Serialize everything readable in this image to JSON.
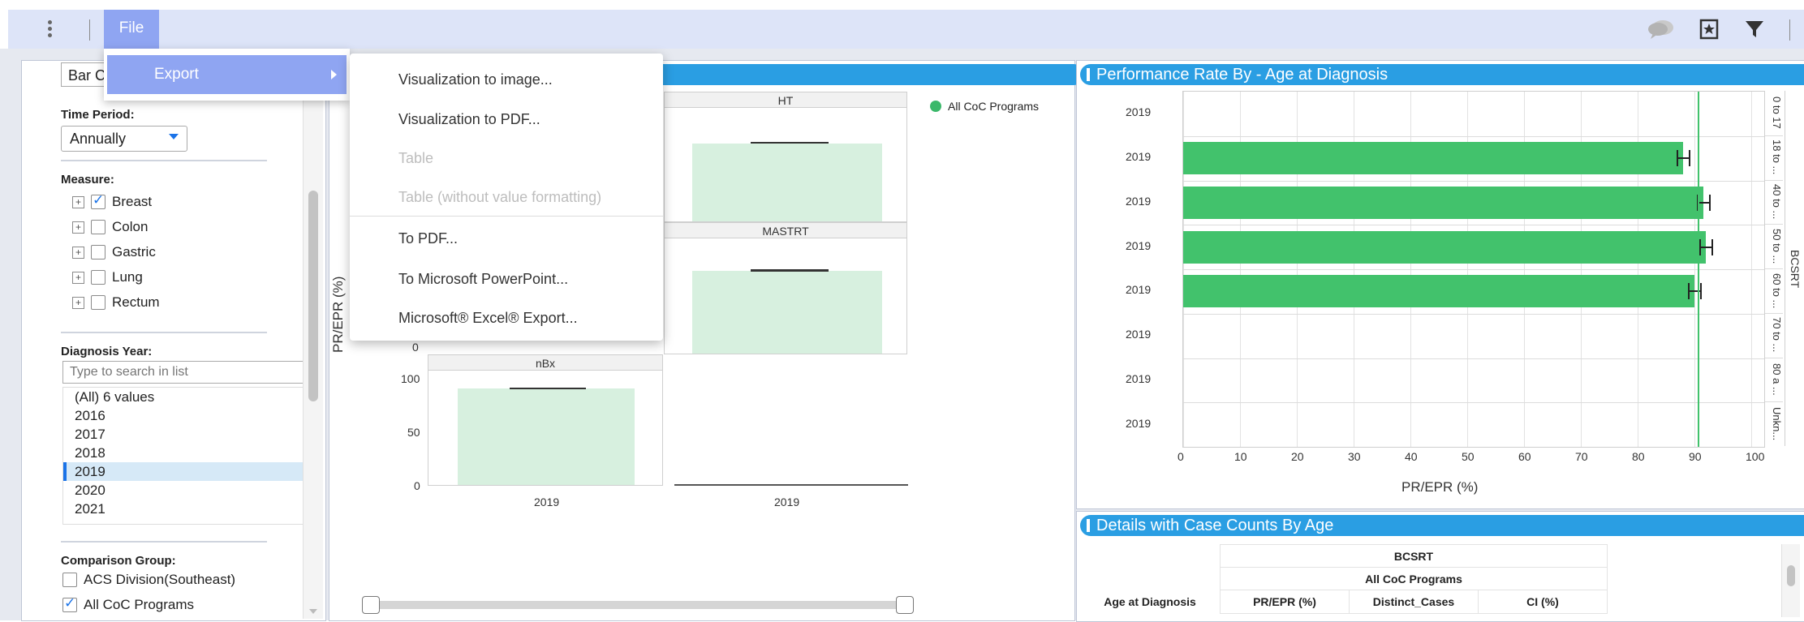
{
  "toolbar": {
    "file_label": "File",
    "icons": [
      "more-vert-icon",
      "comments-icon",
      "bookmark-star-icon",
      "filter-icon"
    ]
  },
  "file_menu": {
    "export_label": "Export"
  },
  "export_submenu": {
    "items": [
      {
        "label": "Visualization to image...",
        "enabled": true
      },
      {
        "label": "Visualization to PDF...",
        "enabled": true
      },
      {
        "label": "Table",
        "enabled": false
      },
      {
        "label": "Table (without value formatting)",
        "enabled": false
      },
      {
        "label": "To PDF...",
        "enabled": true
      },
      {
        "label": "To Microsoft PowerPoint...",
        "enabled": true
      },
      {
        "label": "Microsoft® Excel® Export...",
        "enabled": true
      }
    ]
  },
  "filters": {
    "chart_type_value": "Bar C",
    "time_period_label": "Time Period:",
    "time_period_value": "Annually",
    "measure_label": "Measure:",
    "measures": [
      {
        "label": "Breast",
        "checked": true
      },
      {
        "label": "Colon",
        "checked": false
      },
      {
        "label": "Gastric",
        "checked": false
      },
      {
        "label": "Lung",
        "checked": false
      },
      {
        "label": "Rectum",
        "checked": false
      }
    ],
    "diagnosis_year_label": "Diagnosis Year:",
    "search_placeholder": "Type to search in list",
    "years": [
      "(All) 6 values",
      "2016",
      "2017",
      "2018",
      "2019",
      "2020",
      "2021"
    ],
    "selected_year": "2019",
    "comparison_group_label": "Comparison Group:",
    "comparison_groups": [
      {
        "label": "ACS Division(Southeast)",
        "checked": false
      },
      {
        "label": "All CoC Programs",
        "checked": true
      }
    ]
  },
  "viz_panel": {
    "ylabel": "PR/EPR (%)",
    "legend": "All CoC Programs",
    "legend_color": "#3bb86a",
    "facets": [
      {
        "label": "HT",
        "value": 90
      },
      {
        "label": "MASTRT",
        "value": 93
      },
      {
        "label": "nBx",
        "value": 92
      }
    ],
    "yticks": [
      "100",
      "50",
      "0"
    ],
    "visible_zero_tick": "0",
    "x_categories": [
      "2019",
      "2019"
    ]
  },
  "perf_panel": {
    "title": "Performance Rate By - Age at Diagnosis",
    "xlabel": "PR/EPR (%)",
    "xticks": [
      "0",
      "10",
      "20",
      "30",
      "40",
      "50",
      "60",
      "70",
      "80",
      "90",
      "100"
    ],
    "right_group_label": "BCSRT",
    "bar_color": "#42c26c",
    "reference_line_value": 90.5
  },
  "details_panel": {
    "title": "Details with Case Counts By Age",
    "header_group": "BCSRT",
    "header_subgroup": "All CoC Programs",
    "columns": [
      "Age at Diagnosis",
      "PR/EPR (%)",
      "Distinct_Cases",
      "CI (%)"
    ]
  },
  "chart_data": {
    "type": "bar",
    "orientation": "horizontal",
    "title": "Performance Rate By - Age at Diagnosis",
    "xlabel": "PR/EPR (%)",
    "xlim": [
      0,
      100
    ],
    "categories": [
      "0 to 17",
      "18 to ...",
      "40 to ...",
      "50 to ...",
      "60 to ...",
      "70 to ...",
      "80 a ...",
      "Unkn..."
    ],
    "row_labels": [
      "2019",
      "2019",
      "2019",
      "2019",
      "2019",
      "2019",
      "2019",
      "2019"
    ],
    "series": [
      {
        "name": "All CoC Programs",
        "values": [
          null,
          88,
          91.5,
          92,
          90,
          null,
          null,
          null
        ]
      }
    ],
    "reference_line": 90.5
  }
}
